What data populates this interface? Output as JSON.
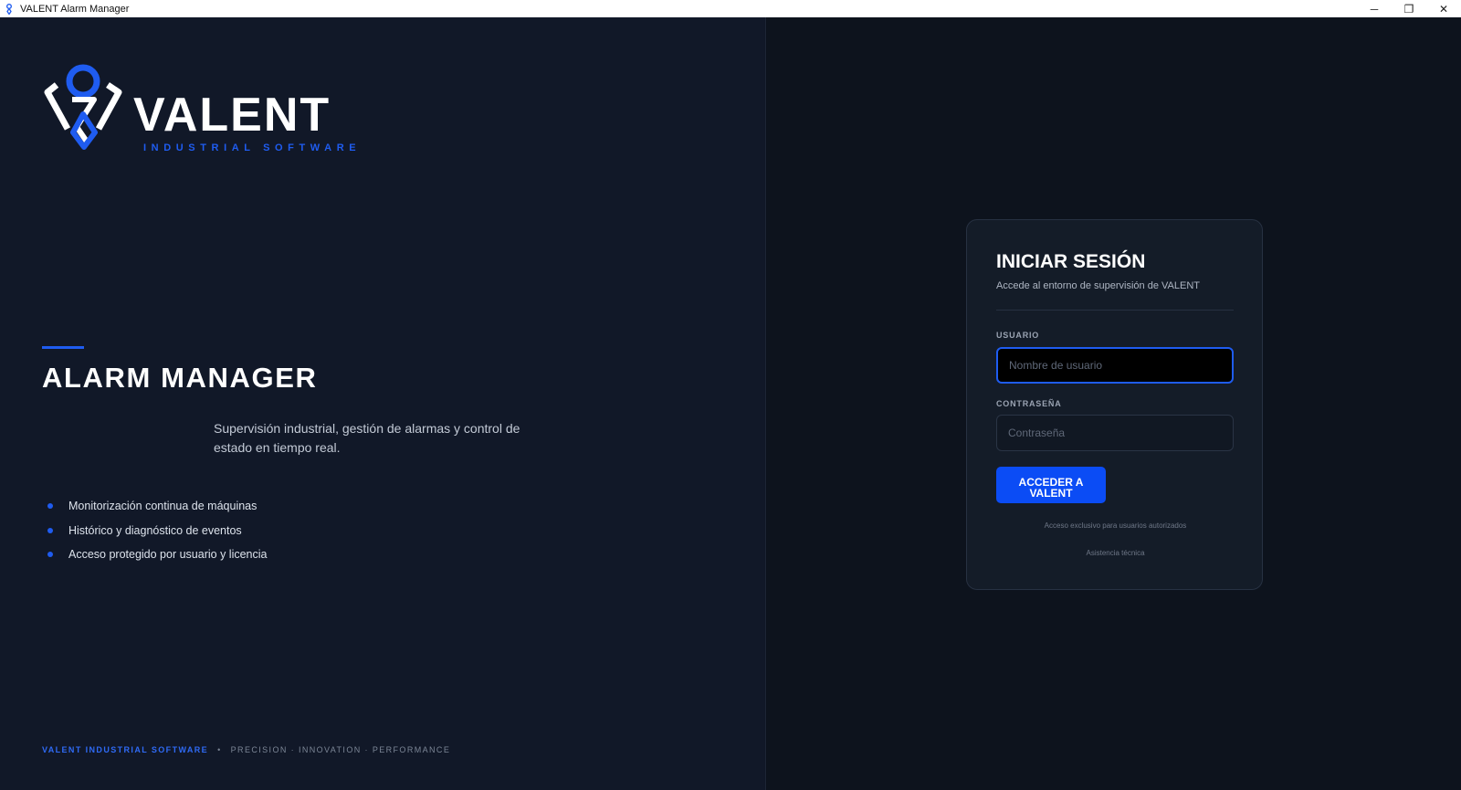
{
  "window": {
    "title": "VALENT Alarm Manager",
    "controls": {
      "minimize": "─",
      "restore": "❐",
      "close": "✕"
    }
  },
  "brand": {
    "name": "VALENT",
    "tagline": "INDUSTRIAL SOFTWARE",
    "accent_color": "#1f5cf0"
  },
  "hero": {
    "title": "ALARM MANAGER",
    "description": "Supervisión industrial, gestión de alarmas y control de estado en tiempo real.",
    "features": [
      "Monitorización continua de máquinas",
      "Histórico y diagnóstico de eventos",
      "Acceso protegido por usuario y licencia"
    ]
  },
  "footer": {
    "brand": "VALENT INDUSTRIAL SOFTWARE",
    "separator": "•",
    "tagline": "PRECISION · INNOVATION · PERFORMANCE"
  },
  "login": {
    "title": "INICIAR SESIÓN",
    "subtitle": "Accede al entorno de supervisión de VALENT",
    "username_label": "USUARIO",
    "username_placeholder": "Nombre de usuario",
    "username_value": "",
    "password_label": "CONTRASEÑA",
    "password_placeholder": "Contraseña",
    "password_value": "",
    "submit_label": "ACCEDER A VALENT",
    "access_note": "Acceso exclusivo para usuarios autorizados",
    "support_link": "Asistencia técnica"
  }
}
